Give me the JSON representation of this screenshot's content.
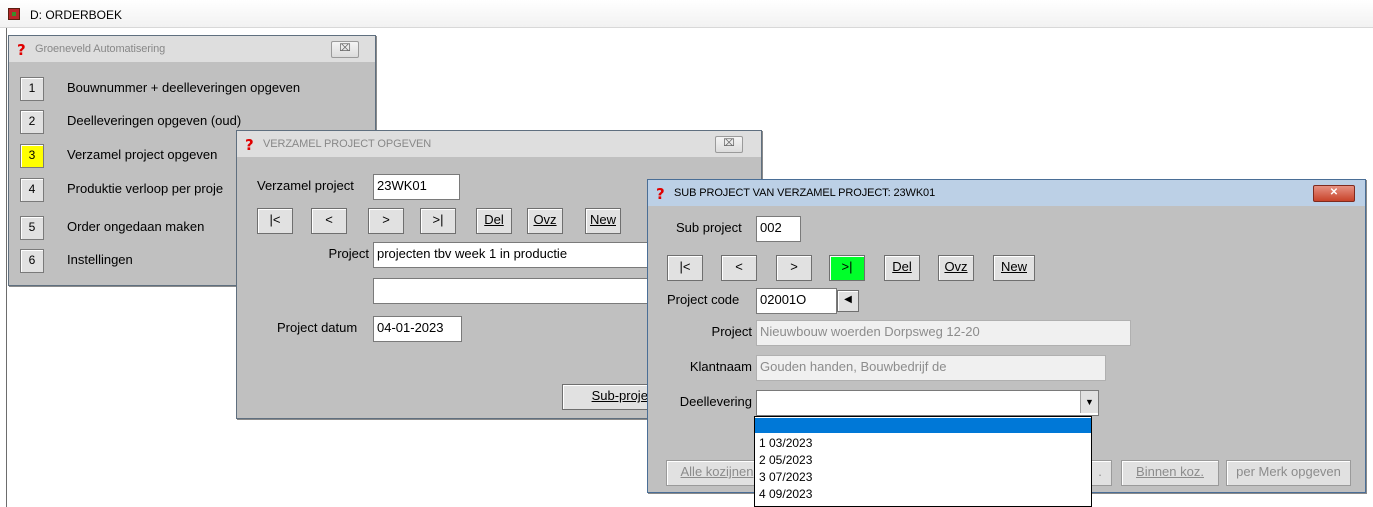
{
  "app": {
    "title": "D: ORDERBOEK"
  },
  "main_window": {
    "title": "Groeneveld Automatisering",
    "close": "⌧",
    "items": [
      {
        "num": "1",
        "label": "Bouwnummer + deelleveringen opgeven"
      },
      {
        "num": "2",
        "label": "Deelleveringen opgeven (oud)"
      },
      {
        "num": "3",
        "label": "Verzamel project opgeven"
      },
      {
        "num": "4",
        "label": "Produktie verloop per proje"
      },
      {
        "num": "5",
        "label": "Order ongedaan maken"
      },
      {
        "num": "6",
        "label": "Instellingen"
      }
    ]
  },
  "verzamel_window": {
    "title": "VERZAMEL PROJECT OPGEVEN",
    "close": "⌧",
    "verzamel_project_label": "Verzamel project",
    "verzamel_project_value": "23WK01",
    "nav": {
      "first": "|<",
      "prev": "<",
      "next": ">",
      "last": ">|",
      "del": "Del",
      "ovz": "Ovz",
      "new": "New"
    },
    "project_label": "Project",
    "project_value": "projecten tbv week 1 in productie",
    "project_extra_value": "",
    "datum_label": "Project datum",
    "datum_value": "04-01-2023",
    "sub_button": "Sub-projec"
  },
  "sub_window": {
    "title": "SUB PROJECT VAN VERZAMEL PROJECT: 23WK01",
    "close": "✕",
    "sub_project_label": "Sub project",
    "sub_project_value": "002",
    "nav": {
      "first": "|<",
      "prev": "<",
      "next": ">",
      "last": ">|",
      "del": "Del",
      "ovz": "Ovz",
      "new": "New"
    },
    "project_code_label": "Project code",
    "project_code_value": "02001O",
    "project_label": "Project",
    "project_value": "Nieuwbouw woerden Dorpsweg 12-20",
    "klantnaam_label": "Klantnaam",
    "klantnaam_value": "Gouden handen, Bouwbedrijf de",
    "deellevering_label": "Deellevering",
    "deellevering_value": "",
    "deellevering_options": [
      "",
      "1  03/2023",
      "2  05/2023",
      "3  07/2023",
      "4  09/2023"
    ],
    "bottom_buttons": {
      "alle": "Alle kozijnen",
      "partial": ".",
      "binnen": "Binnen koz.",
      "merk": "per Merk opgeven"
    }
  }
}
